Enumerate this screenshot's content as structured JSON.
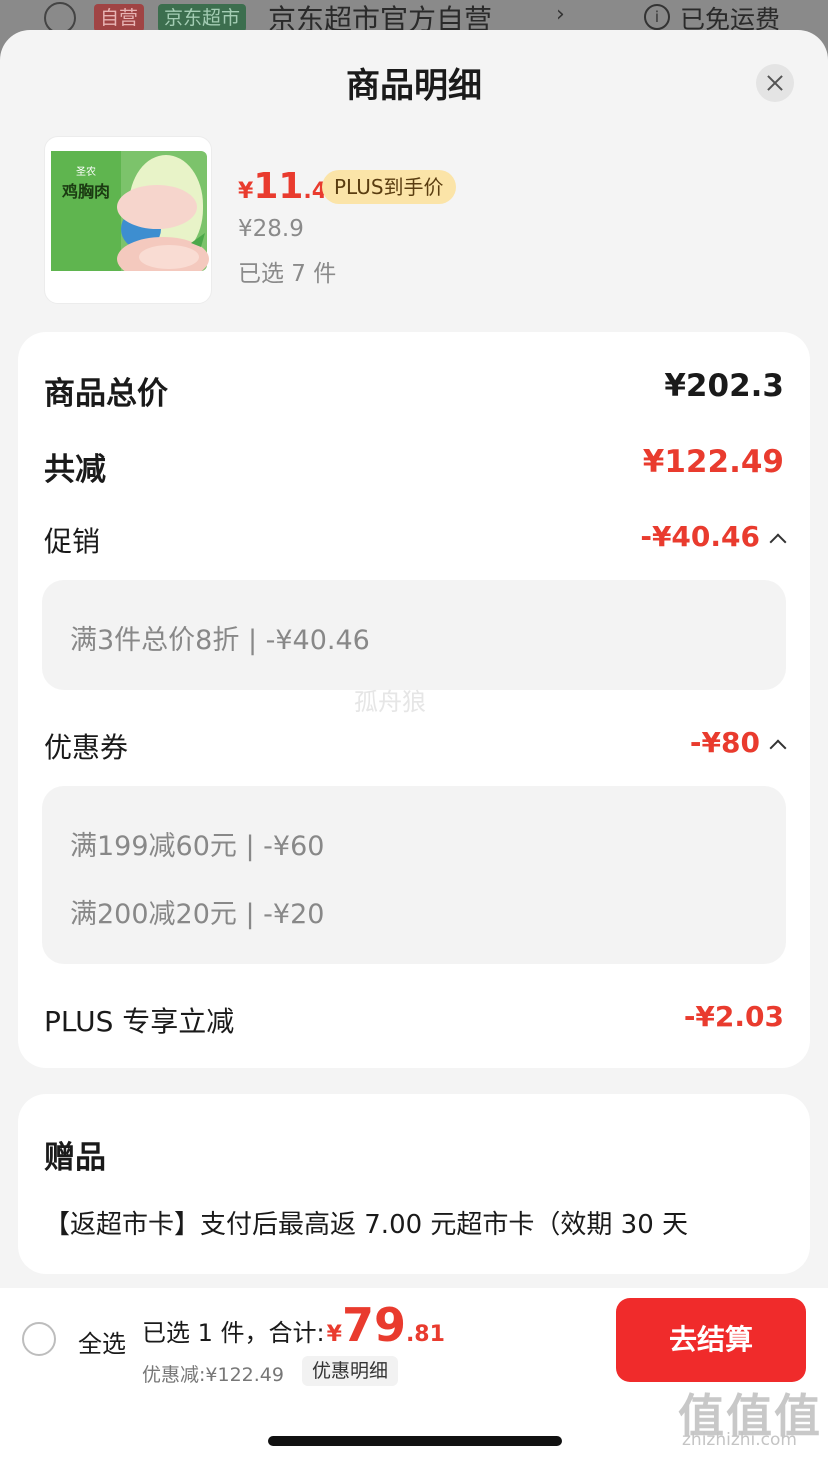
{
  "background": {
    "tag_self": "自营",
    "tag_supermarket": "京东超市",
    "store_name": "京东超市官方自营",
    "shipping": "已免运费"
  },
  "sheet": {
    "title": "商品明细"
  },
  "product": {
    "image_label": "鸡胸肉",
    "brand": "圣农",
    "price_currency": "¥",
    "price_int": "11",
    "price_dec": ".4",
    "plus_tag": "PLUS到手价",
    "original_price": "¥28.9",
    "selected_qty": "已选 7 件"
  },
  "breakdown": {
    "total_label": "商品总价",
    "total_value": "¥202.3",
    "reduce_label": "共减",
    "reduce_value": "¥122.49",
    "promo_label": "促销",
    "promo_value": "-¥40.46",
    "promo_items": [
      "满3件总价8折 | -¥40.46"
    ],
    "coupon_label": "优惠券",
    "coupon_value": "-¥80",
    "coupon_items": [
      "满199减60元 | -¥60",
      "满200减20元 | -¥20"
    ],
    "plus_label": "PLUS 专享立减",
    "plus_value": "-¥2.03",
    "watermark": "孤舟狼"
  },
  "gift": {
    "title": "赠品",
    "text": "【返超市卡】支付后最高返 7.00 元超市卡（效期 30 天"
  },
  "bottom": {
    "select_all": "全选",
    "summary_label": "已选 1 件，合计:",
    "total_currency": "¥",
    "total_int": "79",
    "total_dec": ".81",
    "discount": "优惠减:¥122.49",
    "detail_link": "优惠明细",
    "checkout": "去结算",
    "site_mark": "值值值",
    "site_url": "zhizhizhi.com"
  },
  "colors": {
    "accent_red": "#e93b2e",
    "checkout_red": "#f02b2b",
    "plus_gold": "#fbe4a8"
  }
}
